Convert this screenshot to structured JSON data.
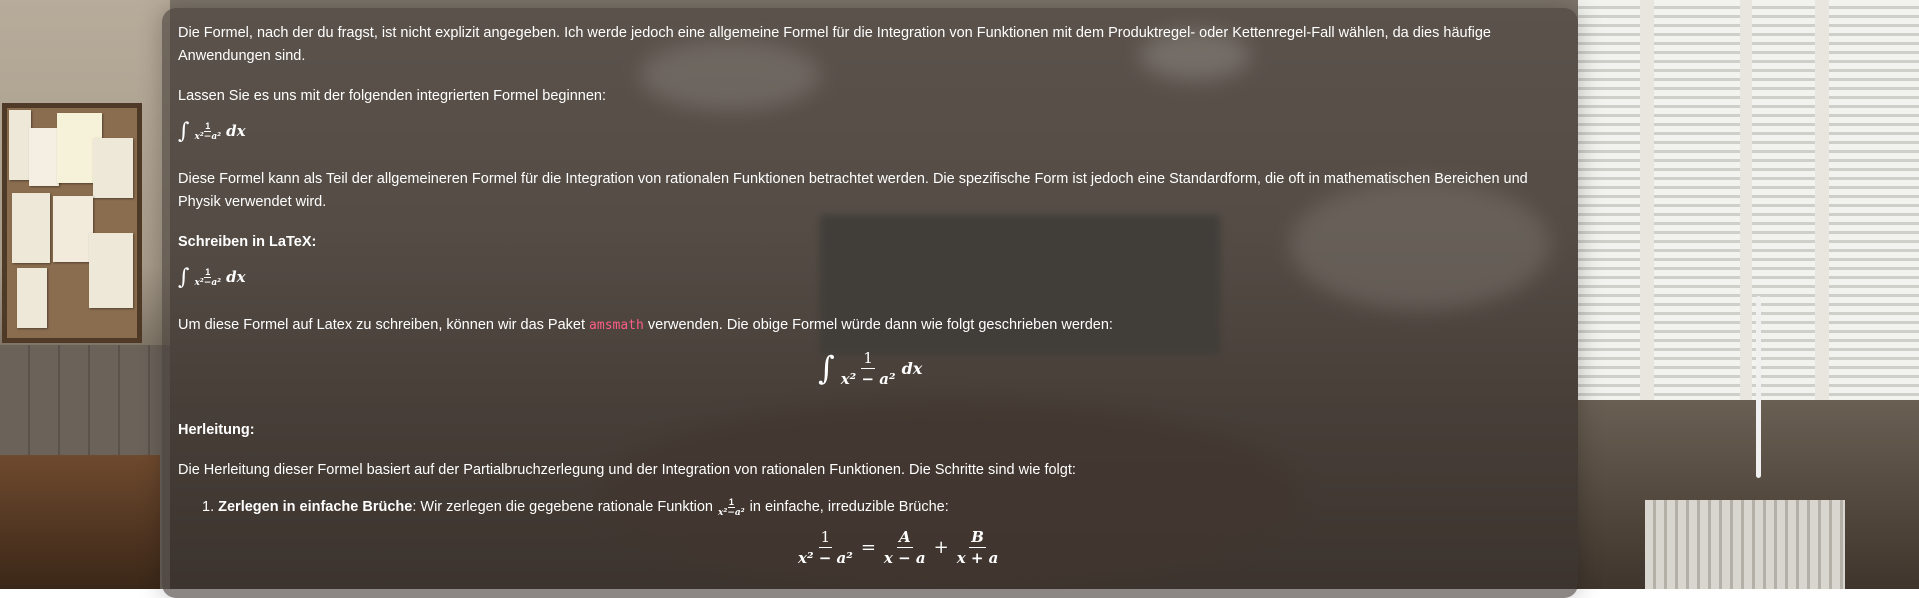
{
  "message": {
    "intro": "Die Formel, nach der du fragst, ist nicht explizit angegeben. Ich werde jedoch eine allgemeine Formel für die Integration von Funktionen mit dem Produktregel- oder Kettenregel-Fall wählen, da dies häufige",
    "intro_cont": "Anwendungen sind.",
    "lead": "Lassen Sie es uns mit der folgenden integrierten Formel beginnen:",
    "formula": {
      "integral": "∫",
      "numerator": "1",
      "denominator": "x²−a²",
      "differential": "dx"
    },
    "desc": "Diese Formel kann als Teil der allgemeineren Formel für die Integration von rationalen Funktionen betrachtet werden. Die spezifische Form ist jedoch eine Standardform, die oft in mathematischen Bereichen und",
    "desc_cont": "Physik verwendet wird.",
    "latex_heading": "Schreiben in LaTeX:",
    "latex_text_before": "Um diese Formel auf Latex zu schreiben, können wir das Paket",
    "package": "amsmath",
    "latex_text_after": "verwenden. Die obige Formel würde dann wie folgt geschrieben werden:",
    "display_formula": {
      "integral": "∫",
      "numerator": "1",
      "denominator": "x² − a²",
      "differential": "dx"
    },
    "derivation_heading": "Herleitung:",
    "derivation_text": "Die Herleitung dieser Formel basiert auf der Partialbruchzerlegung und der Integration von rationalen Funktionen. Die Schritte sind wie folgt:",
    "steps": [
      {
        "number": "1.",
        "title": "Zerlegen in einfache Brüche",
        "text_before": ": Wir zerlegen die gegebene rationale Funktion",
        "text_after": "in einfache, irreduzible Brüche:"
      }
    ],
    "partial_fraction": {
      "lhs_num": "1",
      "lhs_den": "x² − a²",
      "equals": "=",
      "a_num": "A",
      "a_den": "x − a",
      "plus": "+",
      "b_num": "B",
      "b_den": "x + a"
    }
  }
}
